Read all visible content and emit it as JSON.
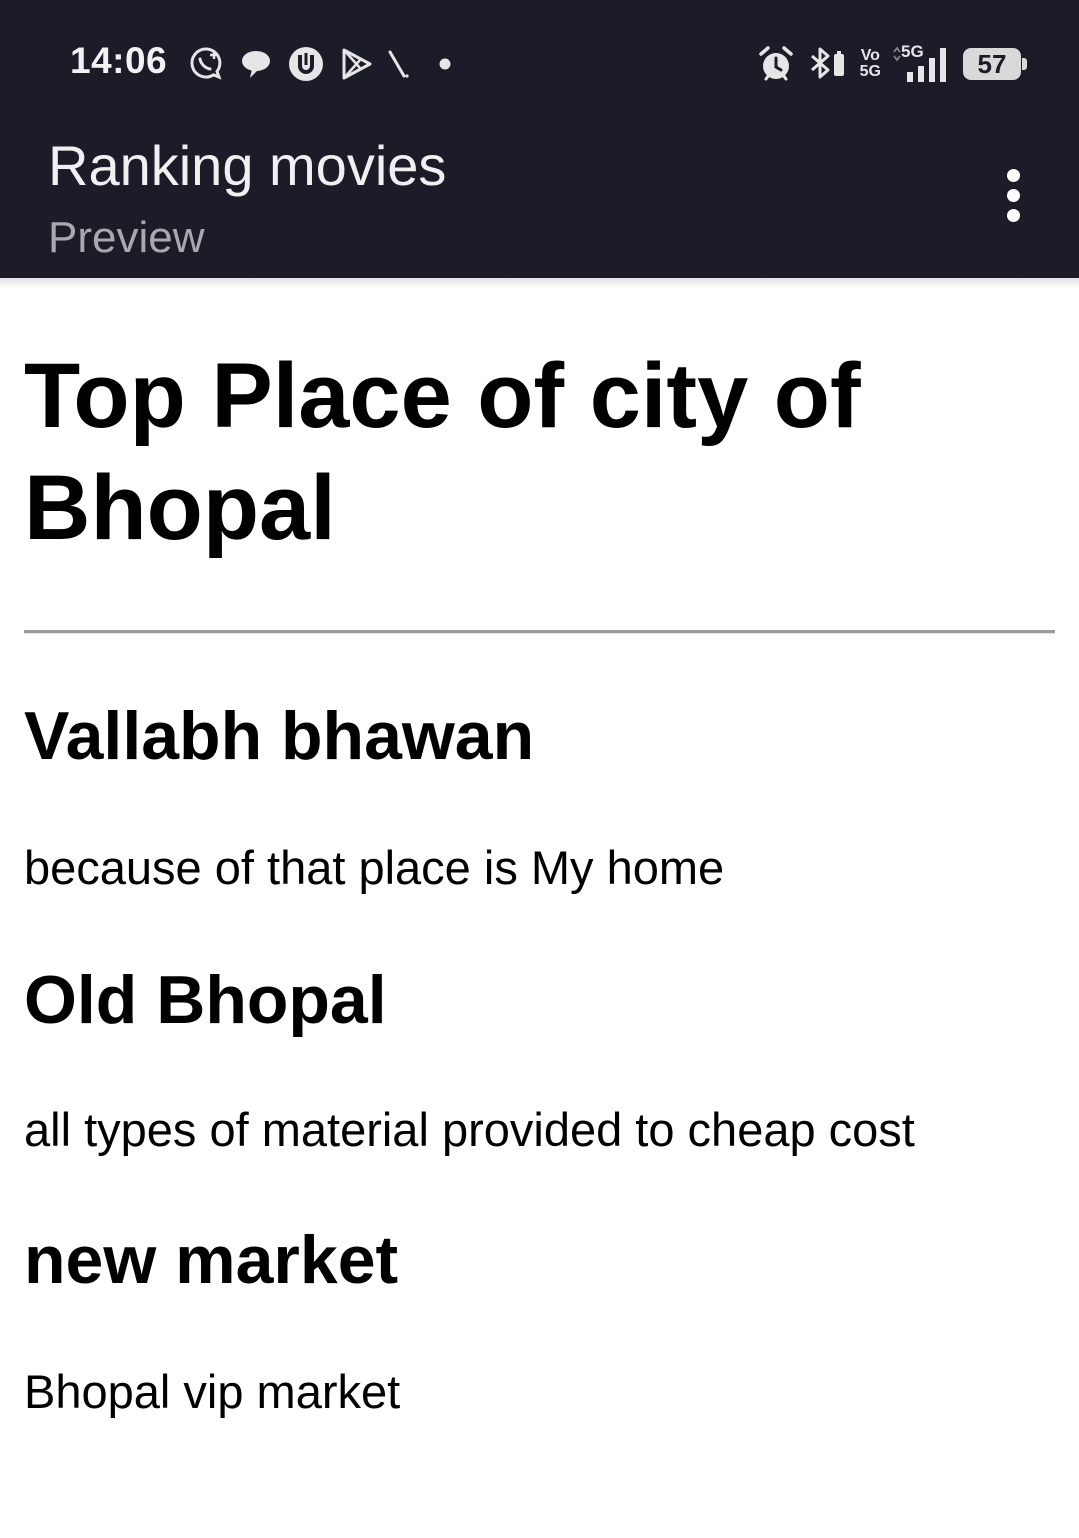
{
  "status_bar": {
    "time": "14:06",
    "left_icons": [
      "whatsapp-business-icon",
      "chat-bubble-icon",
      "shield-u-icon",
      "play-store-icon",
      "slash-icon",
      "dot-icon"
    ],
    "right_icons": [
      "alarm-icon",
      "bluetooth-icon",
      "volte-icon",
      "signal-5g-icon",
      "battery-icon"
    ],
    "volte_label_top": "Vo",
    "volte_label_bottom": "5G",
    "network_label": "5G",
    "battery_level": "57"
  },
  "app_bar": {
    "title": "Ranking movies",
    "subtitle": "Preview",
    "menu_icon": "more-vertical-icon"
  },
  "document": {
    "heading": "Top Place of city of Bhopal",
    "sections": [
      {
        "title": "Vallabh bhawan",
        "body": "because of that place is My home"
      },
      {
        "title": "Old Bhopal",
        "body": "all types of material provided to cheap cost"
      },
      {
        "title": "new market",
        "body": "Bhopal vip market"
      }
    ]
  },
  "colors": {
    "app_bar_bg": "#1b1c28",
    "subtitle": "#a8a9b0",
    "divider": "#9a9a9a"
  }
}
